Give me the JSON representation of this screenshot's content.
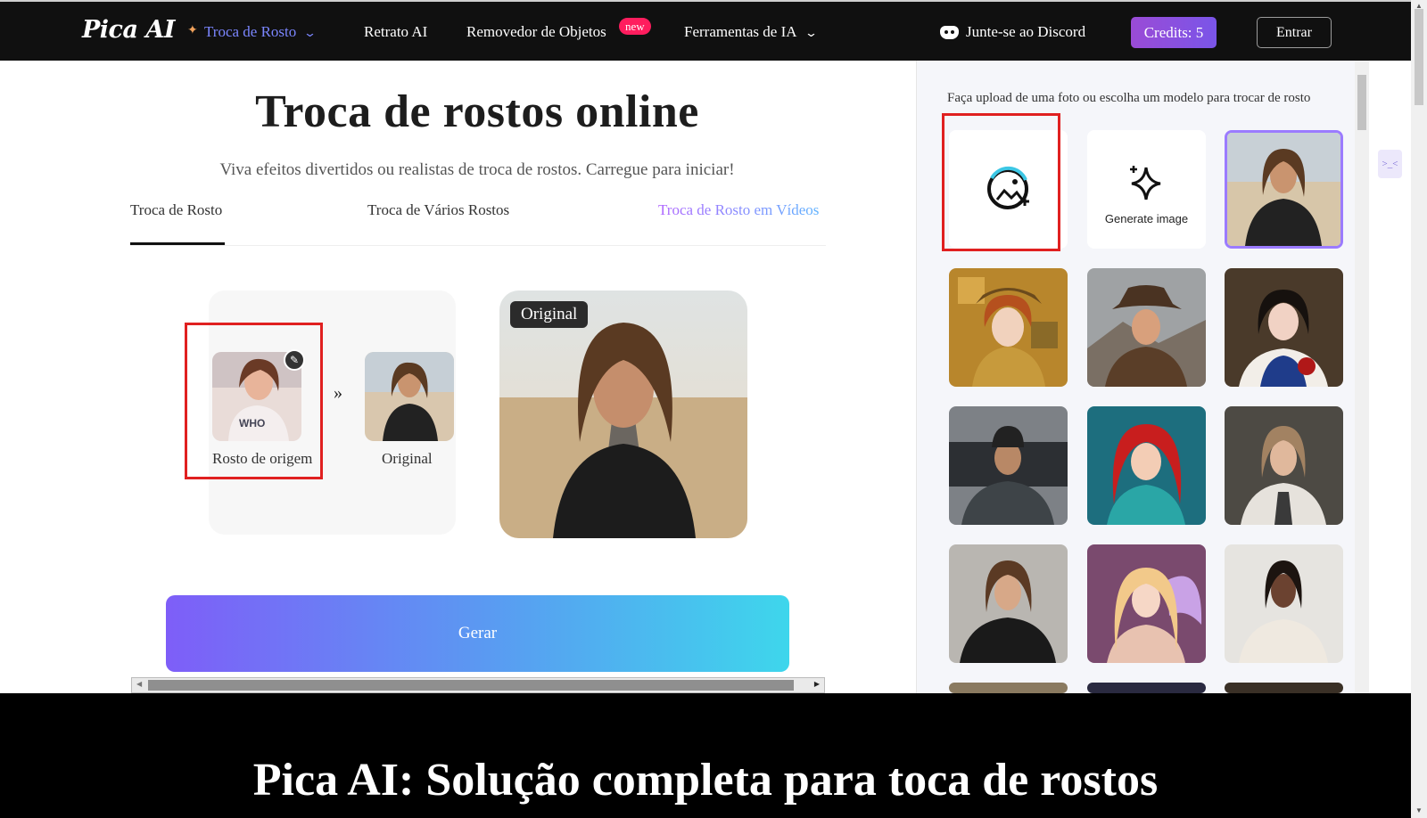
{
  "nav": {
    "logo": "Pica AI",
    "items": [
      {
        "label": "Troca de Rosto",
        "active": true
      },
      {
        "label": "Retrato AI"
      },
      {
        "label": "Removedor de Objetos",
        "badge": "new"
      },
      {
        "label": "Ferramentas de IA"
      }
    ],
    "discord": "Junte-se ao Discord",
    "credits": "Credits: 5",
    "login": "Entrar"
  },
  "main": {
    "title": "Troca de rostos online",
    "subtitle": "Viva efeitos divertidos ou realistas de troca de rostos. Carregue para iniciar!",
    "tabs": [
      "Troca de Rosto",
      "Troca de Vários Rostos",
      "Troca de Rosto em Vídeos"
    ],
    "source_label": "Rosto de origem",
    "target_label": "Original",
    "preview_badge": "Original",
    "arrow": "»",
    "generate": "Gerar"
  },
  "side": {
    "hint": "Faça upload de uma foto ou escolha um modelo para trocar de rosto",
    "generate_label": "Generate image"
  },
  "caption": "Pica AI: Solução completa para toca de rostos",
  "colors": {
    "accent": "#7b86ff",
    "badge": "#ff1d5e",
    "highlight": "#e02020",
    "credits": "#8a4fe0"
  }
}
